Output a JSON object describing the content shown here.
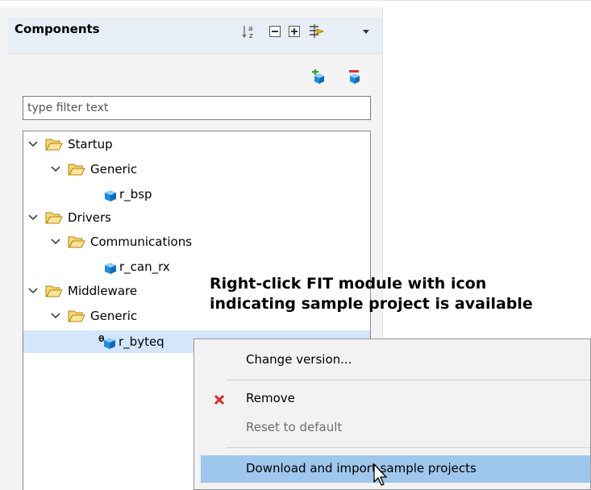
{
  "panel": {
    "title": "Components",
    "toolbar": [
      "sort-alphabetically-icon",
      "collapse-all-icon",
      "expand-all-icon",
      "filter-options-icon",
      "view-menu-icon"
    ],
    "filter_placeholder": "type filter text"
  },
  "tree": {
    "startup": "Startup",
    "startup_generic": "Generic",
    "r_bsp": "r_bsp",
    "drivers": "Drivers",
    "communications": "Communications",
    "r_can_rx": "r_can_rx",
    "middleware": "Middleware",
    "middleware_generic": "Generic",
    "r_byteq": "r_byteq",
    "selected": "r_byteq"
  },
  "callout": {
    "line1": "Right-click FIT module with icon",
    "line2": "indicating sample project is available"
  },
  "context_menu": {
    "change_version": "Change version...",
    "remove": "Remove",
    "reset_default": "Reset to default",
    "download_import": "Download and import sample projects",
    "highlighted": "Download and import sample projects",
    "colors": {
      "highlight": "#9fc6ec",
      "disabled_text": "#6d6d6d",
      "remove_icon": "#d82a2a"
    }
  },
  "colors": {
    "selection": "#d3e6fb",
    "header": "#e8eef5",
    "folder": "#e8a600",
    "cube": "#1f8be0"
  }
}
